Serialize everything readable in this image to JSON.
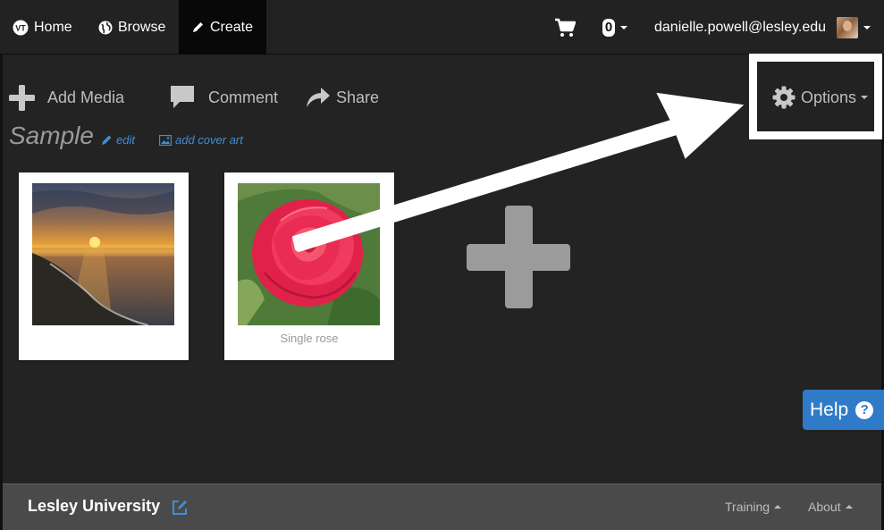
{
  "nav": {
    "home_label": "Home",
    "browse_label": "Browse",
    "create_label": "Create",
    "cart_count": "0",
    "user_email": "danielle.powell@lesley.edu"
  },
  "toolbar": {
    "add_media_label": "Add Media",
    "comment_label": "Comment",
    "share_label": "Share",
    "options_label": "Options"
  },
  "collection": {
    "title": "Sample",
    "edit_label": "edit",
    "cover_art_label": "add cover art"
  },
  "media": [
    {
      "caption": ""
    },
    {
      "caption": "Single rose"
    }
  ],
  "help_label": "Help",
  "footer": {
    "brand": "Lesley University",
    "training_label": "Training",
    "about_label": "About"
  },
  "colors": {
    "background": "#232323",
    "navbar": "#222222",
    "active_nav": "#080808",
    "link_blue": "#3f8fd6",
    "help_blue": "#2f7bc8",
    "footer": "#4a4a4a"
  },
  "icons": [
    "logo-icon",
    "globe-icon",
    "pencil-icon",
    "cart-icon",
    "plus-icon",
    "comment-icon",
    "share-icon",
    "gear-icon",
    "image-icon",
    "question-icon",
    "edit-square-icon"
  ]
}
